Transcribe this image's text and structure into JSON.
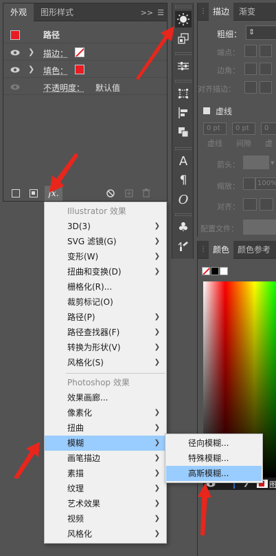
{
  "appearance": {
    "tabs": [
      "外观",
      "图形样式"
    ],
    "controls": ">>",
    "rows": {
      "path": "路径",
      "stroke": "描边：",
      "fill": "填色：",
      "opacity": "不透明度：",
      "opacity_value": "默认值"
    },
    "fx_label": "fx."
  },
  "effect_menu": {
    "illustrator_header": "Illustrator 效果",
    "illustrator_items": [
      {
        "label": "3D(3)",
        "sub": true
      },
      {
        "label": "SVG 滤镜(G)",
        "sub": true
      },
      {
        "label": "变形(W)",
        "sub": true
      },
      {
        "label": "扭曲和变换(D)",
        "sub": true
      },
      {
        "label": "栅格化(R)...",
        "sub": false
      },
      {
        "label": "裁剪标记(O)",
        "sub": false
      },
      {
        "label": "路径(P)",
        "sub": true
      },
      {
        "label": "路径查找器(F)",
        "sub": true
      },
      {
        "label": "转换为形状(V)",
        "sub": true
      },
      {
        "label": "风格化(S)",
        "sub": true
      }
    ],
    "photoshop_header": "Photoshop 效果",
    "photoshop_items": [
      {
        "label": "效果画廊...",
        "sub": false
      },
      {
        "label": "像素化",
        "sub": true
      },
      {
        "label": "扭曲",
        "sub": true
      },
      {
        "label": "模糊",
        "sub": true
      },
      {
        "label": "画笔描边",
        "sub": true
      },
      {
        "label": "素描",
        "sub": true
      },
      {
        "label": "纹理",
        "sub": true
      },
      {
        "label": "艺术效果",
        "sub": true
      },
      {
        "label": "视频",
        "sub": true
      },
      {
        "label": "风格化",
        "sub": true
      }
    ],
    "highlighted": "模糊"
  },
  "blur_submenu": {
    "items": [
      "径向模糊...",
      "特殊模糊...",
      "高斯模糊..."
    ],
    "highlighted": "高斯模糊..."
  },
  "stroke_panel": {
    "tabs": [
      "描边",
      "渐变"
    ],
    "weight_label": "粗细：",
    "cap_label": "端点：",
    "corner_label": "边角：",
    "align_label": "对齐描边：",
    "dashed_label": "虚线",
    "dash_inputs": [
      "0 pt",
      "0 pt",
      "0"
    ],
    "dash_sub_labels": [
      "虚线",
      "间隙",
      "虚"
    ],
    "arrow_label": "箭头：",
    "scale_label": "缩放：",
    "scale_value": "100%",
    "align2_label": "对齐：",
    "profile_label": "配置文件："
  },
  "color_panel": {
    "tabs": [
      "颜色",
      "颜色参考"
    ]
  },
  "bottom_strip_label": "图",
  "colors": {
    "accent_red": "#e81d23",
    "menu_highlight": "#99ccff",
    "arrow_red": "#e8261c"
  }
}
